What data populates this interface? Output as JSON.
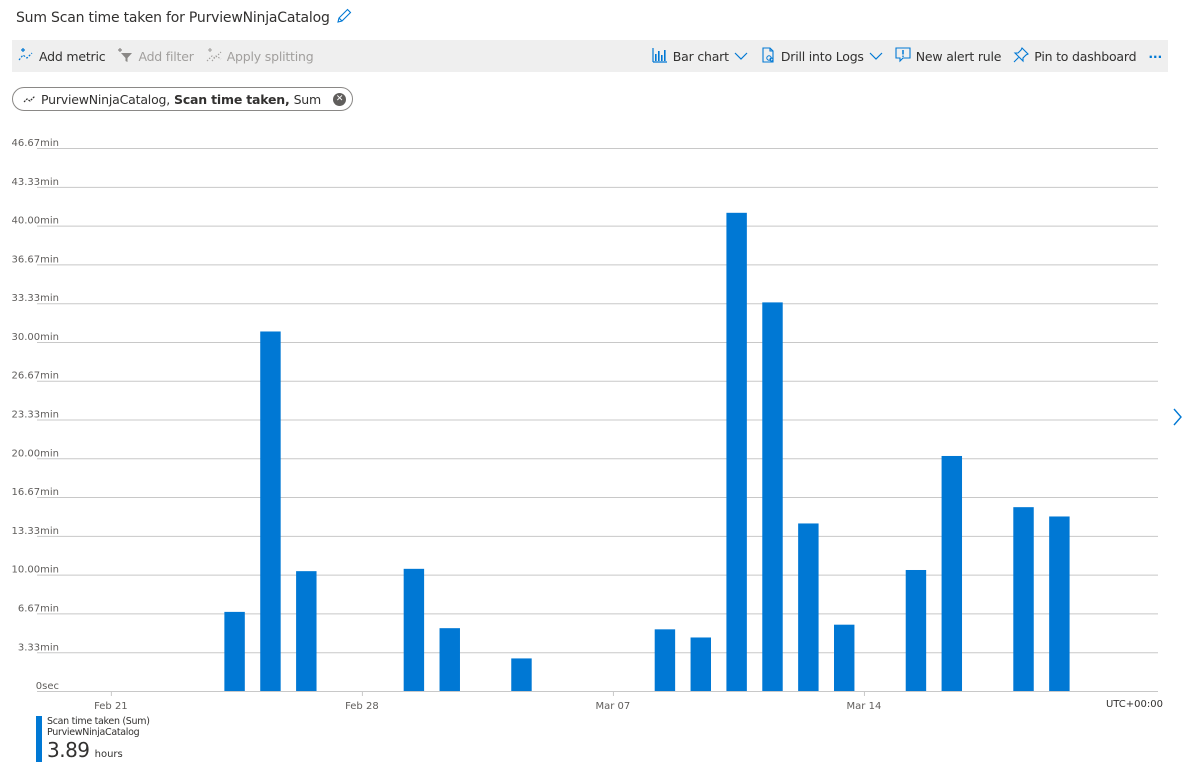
{
  "header": {
    "title": "Sum Scan time taken for PurviewNinjaCatalog",
    "edit_icon": "pencil-icon"
  },
  "toolbar": {
    "add_metric": "Add metric",
    "add_filter": "Add filter",
    "apply_splitting": "Apply splitting",
    "bar_chart": "Bar chart",
    "drill_into_logs": "Drill into Logs",
    "new_alert_rule": "New alert rule",
    "pin_to_dashboard": "Pin to dashboard",
    "more": "···"
  },
  "metric_pill": {
    "resource": "PurviewNinjaCatalog,",
    "metric": "Scan time taken,",
    "aggregation": "Sum"
  },
  "colors": {
    "bar": "#0078d4",
    "accent": "#0078d4",
    "grid": "#c8c8c8"
  },
  "timezone": "UTC+00:00",
  "legend": {
    "series_label": "Scan time taken (Sum)",
    "resource": "PurviewNinjaCatalog",
    "total_value": "3.89",
    "total_unit": "hours"
  },
  "chart_data": {
    "type": "bar",
    "title": "Sum Scan time taken for PurviewNinjaCatalog",
    "xlabel": "",
    "ylabel": "",
    "y_unit": "min",
    "ylim": [
      0,
      46.67
    ],
    "y_ticks": [
      {
        "value": 0,
        "label": "0sec"
      },
      {
        "value": 3.33,
        "label": "3.33min"
      },
      {
        "value": 6.67,
        "label": "6.67min"
      },
      {
        "value": 10.0,
        "label": "10.00min"
      },
      {
        "value": 13.33,
        "label": "13.33min"
      },
      {
        "value": 16.67,
        "label": "16.67min"
      },
      {
        "value": 20.0,
        "label": "20.00min"
      },
      {
        "value": 23.33,
        "label": "23.33min"
      },
      {
        "value": 26.67,
        "label": "26.67min"
      },
      {
        "value": 30.0,
        "label": "30.00min"
      },
      {
        "value": 33.33,
        "label": "33.33min"
      },
      {
        "value": 36.67,
        "label": "36.67min"
      },
      {
        "value": 40.0,
        "label": "40.00min"
      },
      {
        "value": 43.33,
        "label": "43.33min"
      },
      {
        "value": 46.67,
        "label": "46.67min"
      }
    ],
    "x_range_days": [
      -2.06,
      29.2
    ],
    "x_origin": "Feb 21",
    "x_ticks": [
      {
        "day": 0,
        "label": "Feb 21"
      },
      {
        "day": 7,
        "label": "Feb 28"
      },
      {
        "day": 14,
        "label": "Mar 07"
      },
      {
        "day": 21,
        "label": "Mar 14"
      }
    ],
    "grid": true,
    "legend_position": "bottom-left",
    "series": [
      {
        "name": "Scan time taken (Sum) - PurviewNinjaCatalog",
        "points": [
          {
            "date": "Feb 24",
            "day": 3,
            "value": 6.8
          },
          {
            "date": "Feb 25",
            "day": 4,
            "value": 30.9
          },
          {
            "date": "Feb 26",
            "day": 5,
            "value": 10.3
          },
          {
            "date": "Mar 01",
            "day": 8,
            "value": 10.5
          },
          {
            "date": "Mar 02",
            "day": 9,
            "value": 5.4
          },
          {
            "date": "Mar 04",
            "day": 11,
            "value": 2.8
          },
          {
            "date": "Mar 08",
            "day": 15,
            "value": 5.3
          },
          {
            "date": "Mar 09",
            "day": 16,
            "value": 4.6
          },
          {
            "date": "Mar 10",
            "day": 17,
            "value": 41.1
          },
          {
            "date": "Mar 11",
            "day": 18,
            "value": 33.4
          },
          {
            "date": "Mar 12",
            "day": 19,
            "value": 14.4
          },
          {
            "date": "Mar 13",
            "day": 20,
            "value": 5.7
          },
          {
            "date": "Mar 15",
            "day": 22,
            "value": 10.4
          },
          {
            "date": "Mar 16",
            "day": 23,
            "value": 20.2
          },
          {
            "date": "Mar 18",
            "day": 25,
            "value": 15.8
          },
          {
            "date": "Mar 19",
            "day": 26,
            "value": 15.0
          }
        ]
      }
    ]
  }
}
